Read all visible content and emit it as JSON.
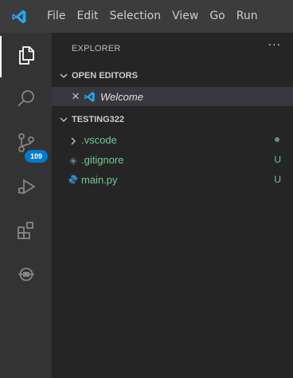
{
  "menubar": {
    "items": [
      "File",
      "Edit",
      "Selection",
      "View",
      "Go",
      "Run"
    ]
  },
  "activitybar": {
    "items": [
      {
        "icon": "files-icon",
        "active": true
      },
      {
        "icon": "search-icon"
      },
      {
        "icon": "source-control-icon",
        "badge": "109"
      },
      {
        "icon": "run-debug-icon"
      },
      {
        "icon": "extensions-icon"
      },
      {
        "icon": "remote-explorer-icon"
      }
    ]
  },
  "sidebar": {
    "title": "EXPLORER",
    "more": "···",
    "open_editors": {
      "label": "OPEN EDITORS",
      "items": [
        {
          "label": "Welcome",
          "close": "×"
        }
      ]
    },
    "workspace": {
      "label": "TESTING322",
      "items": [
        {
          "label": ".vscode",
          "kind": "folder",
          "status": ""
        },
        {
          "label": ".gitignore",
          "kind": "file",
          "status": "U"
        },
        {
          "label": "main.py",
          "kind": "python",
          "status": "U"
        }
      ]
    }
  },
  "colors": {
    "accent": "#007acc",
    "vscode_blue": "#23a9f2",
    "git_untracked": "#73c991"
  }
}
